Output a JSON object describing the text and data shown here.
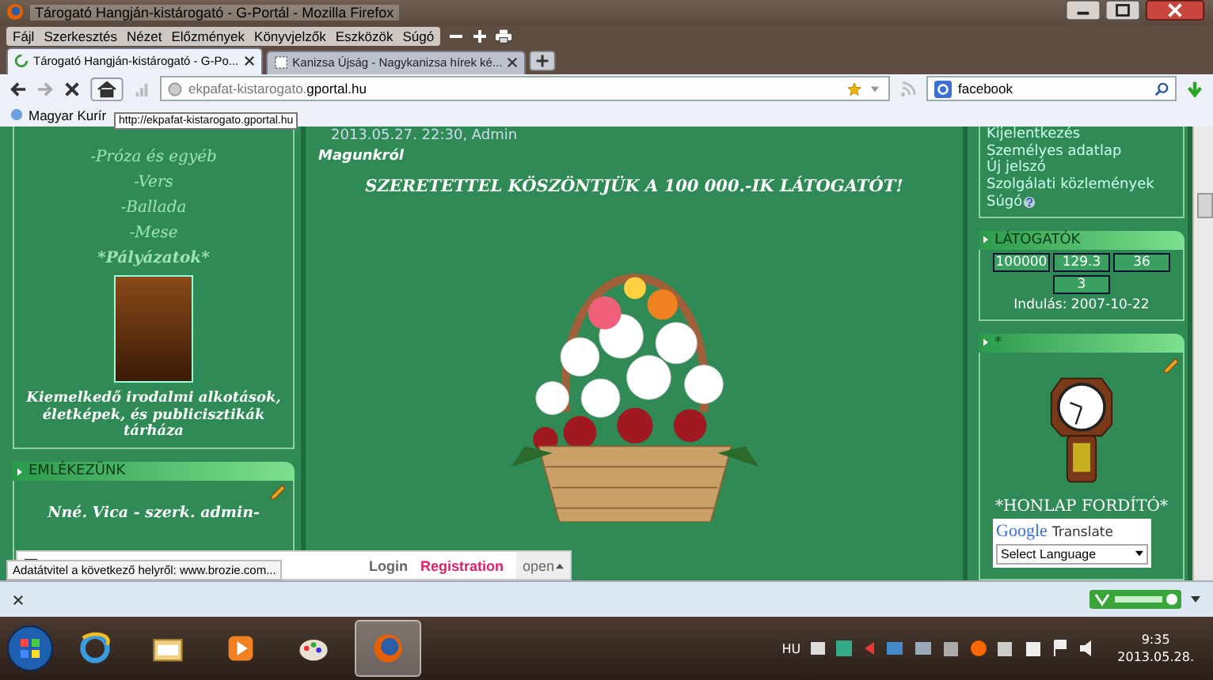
{
  "window": {
    "title": "Tárogató Hangján-kistárogató - G-Portál - Mozilla Firefox"
  },
  "menu": [
    "Fájl",
    "Szerkesztés",
    "Nézet",
    "Előzmények",
    "Könyvjelzők",
    "Eszközök",
    "Súgó"
  ],
  "tabs": [
    {
      "label": "Tárogató Hangján-kistárogató - G-Po...",
      "selected": true,
      "loading": true
    },
    {
      "label": "Kanizsa Újság - Nagykanizsa hírek ké...",
      "selected": false,
      "loading": false
    }
  ],
  "navbar": {
    "url_prefix": "ekpafat-kistarogato.",
    "url_domain": "gportal.hu",
    "search": "facebook"
  },
  "bookmarks": [
    "Magyar Kurír"
  ],
  "tooltip": "http://ekpafat-kistarogato.gportal.hu",
  "left_column": {
    "links": [
      "-Próza és egyéb",
      "-Vers",
      "-Ballada",
      "-Mese"
    ],
    "highlight": "*Pályázatok*",
    "caption": "Kiemelkedő irodalmi alkotások, életképek, és publicisztikák tárháza",
    "box_title": "EMLÉKEZÜNK",
    "box_text": "Nné. Vica - szerk. admin-"
  },
  "center": {
    "meta": "2013.05.27. 22:30, Admin",
    "title": "Magunkról",
    "headline": "SZERETETTEL KÖSZÖNTJÜK A 100 000.-IK LÁTOGATÓT!"
  },
  "right_column": {
    "links": [
      "Kijelentkezés",
      "Személyes adatlap",
      "Új jelszó",
      "Szolgálati közlemények",
      "Súgó"
    ],
    "visitors_title": "LÁTOGATÓK",
    "counters": [
      "100000",
      "129.3",
      "36",
      "3"
    ],
    "started": "Indulás: 2007-10-22",
    "box_title": "*",
    "translator_heading": "*HONLAP FORDÍTÓ*",
    "google_logo": "Google",
    "translate": "Translate",
    "select": "Select Language"
  },
  "login_bar": {
    "login": "Login",
    "registration": "Registration",
    "open": "open"
  },
  "status": "Adatátvitel a következő helyről: www.brozie.com...",
  "taskbar": {
    "apps": [
      {
        "kind": "ie",
        "selected": false
      },
      {
        "kind": "folder",
        "selected": false
      },
      {
        "kind": "media",
        "selected": false
      },
      {
        "kind": "paint",
        "selected": false
      },
      {
        "kind": "firefox",
        "selected": true
      }
    ],
    "language": "HU",
    "time": "9:35",
    "date": "2013.05.28."
  }
}
